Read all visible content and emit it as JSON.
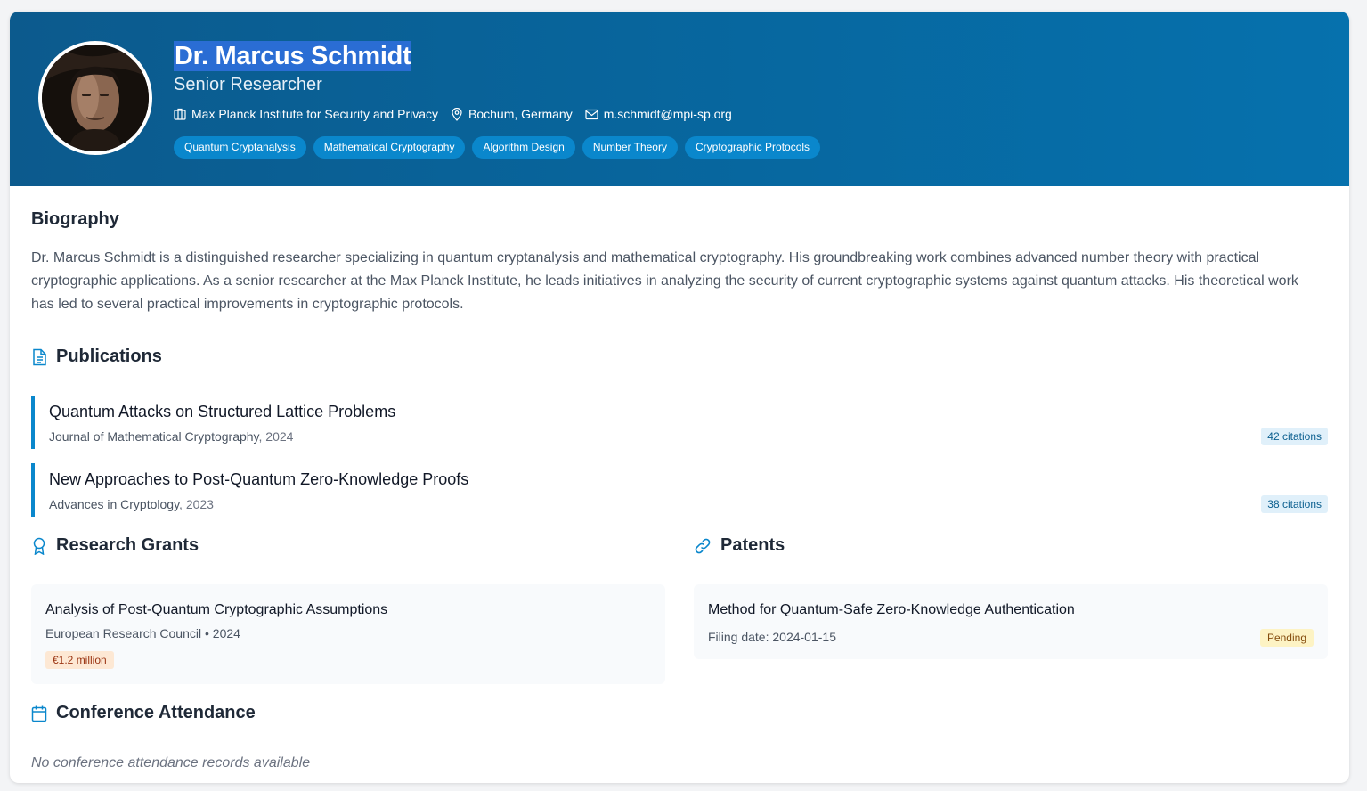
{
  "profile": {
    "name": "Dr. Marcus Schmidt",
    "title": "Senior Researcher",
    "institution": "Max Planck Institute for Security and Privacy",
    "location": "Bochum, Germany",
    "email": "m.schmidt@mpi-sp.org",
    "tags": [
      "Quantum Cryptanalysis",
      "Mathematical Cryptography",
      "Algorithm Design",
      "Number Theory",
      "Cryptographic Protocols"
    ]
  },
  "biography": {
    "heading": "Biography",
    "text": "Dr. Marcus Schmidt is a distinguished researcher specializing in quantum cryptanalysis and mathematical cryptography. His groundbreaking work combines advanced number theory with practical cryptographic applications. As a senior researcher at the Max Planck Institute, he leads initiatives in analyzing the security of current cryptographic systems against quantum attacks. His theoretical work has led to several practical improvements in cryptographic protocols."
  },
  "publications": {
    "heading": "Publications",
    "items": [
      {
        "title": "Quantum Attacks on Structured Lattice Problems",
        "venue": "Journal of Mathematical Cryptography",
        "year": ", 2024",
        "citations": "42 citations"
      },
      {
        "title": "New Approaches to Post-Quantum Zero-Knowledge Proofs",
        "venue": "Advances in Cryptology",
        "year": ", 2023",
        "citations": "38 citations"
      }
    ]
  },
  "grants": {
    "heading": "Research Grants",
    "items": [
      {
        "title": "Analysis of Post-Quantum Cryptographic Assumptions",
        "subtitle": "European Research Council • 2024",
        "amount": "€1.2 million"
      }
    ]
  },
  "patents": {
    "heading": "Patents",
    "items": [
      {
        "title": "Method for Quantum-Safe Zero-Knowledge Authentication",
        "filing": "Filing date: 2024-01-15",
        "status": "Pending"
      }
    ]
  },
  "conferences": {
    "heading": "Conference Attendance",
    "empty": "No conference attendance records available"
  },
  "theme": {
    "accent": "#0a87cc",
    "header_bg": "#07679f",
    "name_highlight": "#2a6dd4"
  },
  "icons": [
    "building-icon",
    "map-pin-icon",
    "mail-icon",
    "document-icon",
    "award-icon",
    "link-icon",
    "calendar-icon"
  ]
}
